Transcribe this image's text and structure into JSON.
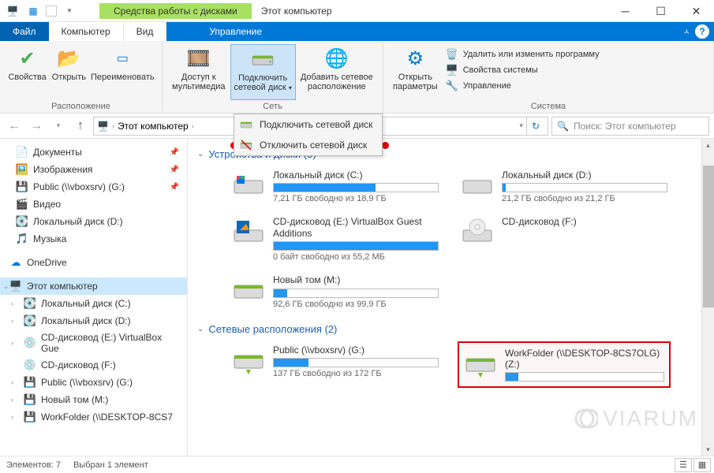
{
  "window": {
    "contextual_tab": "Средства работы с дисками",
    "title": "Этот компьютер"
  },
  "tabs": {
    "file": "Файл",
    "computer": "Компьютер",
    "view": "Вид",
    "manage": "Управление"
  },
  "ribbon": {
    "group_location": "Расположение",
    "group_network": "Сеть",
    "group_system": "Система",
    "properties": "Свойства",
    "open": "Открыть",
    "rename": "Переименовать",
    "media_access": "Доступ к\nмультимедиа",
    "map_network_drive": "Подключить\nсетевой диск",
    "add_network_location": "Добавить сетевое\nрасположение",
    "open_settings": "Открыть\nпараметры",
    "uninstall": "Удалить или изменить программу",
    "system_properties": "Свойства системы",
    "manage": "Управление"
  },
  "dropdown": {
    "connect": "Подключить сетевой диск",
    "disconnect": "Отключить сетевой диск"
  },
  "breadcrumb": {
    "this_pc": "Этот компьютер"
  },
  "search": {
    "placeholder": "Поиск: Этот компьютер"
  },
  "sidebar": {
    "documents": "Документы",
    "pictures": "Изображения",
    "public_g": "Public (\\\\vboxsrv) (G:)",
    "video": "Видео",
    "local_d": "Локальный диск (D:)",
    "music": "Музыка",
    "onedrive": "OneDrive",
    "this_pc": "Этот компьютер",
    "local_c": "Локальный диск (C:)",
    "local_d2": "Локальный диск (D:)",
    "cd_e": "CD-дисковод (E:) VirtualBox Gue",
    "cd_f": "CD-дисковод (F:)",
    "public_g2": "Public (\\\\vboxsrv) (G:)",
    "new_vol_m": "Новый том (M:)",
    "workfolder_z": "WorkFolder (\\\\DESKTOP-8CS7"
  },
  "sections": {
    "devices": "Устройства и диски (5)",
    "network": "Сетевые расположения (2)"
  },
  "drives": {
    "c": {
      "name": "Локальный диск (C:)",
      "free": "7,21 ГБ свободно из 18,9 ГБ",
      "fill": 62
    },
    "d": {
      "name": "Локальный диск (D:)",
      "free": "21,2 ГБ свободно из 21,2 ГБ",
      "fill": 2
    },
    "e": {
      "name": "CD-дисковод (E:) VirtualBox Guest Additions",
      "free": "0 байт свободно из 55,2 МБ",
      "fill": 100
    },
    "f": {
      "name": "CD-дисковод (F:)",
      "free": "",
      "fill": 0
    },
    "m": {
      "name": "Новый том (M:)",
      "free": "92,6 ГБ свободно из 99,9 ГБ",
      "fill": 8
    },
    "g": {
      "name": "Public (\\\\vboxsrv) (G:)",
      "free": "137 ГБ свободно из 172 ГБ",
      "fill": 21
    },
    "z": {
      "name": "WorkFolder (\\\\DESKTOP-8CS7OLG) (Z:)",
      "free": "",
      "fill": 8
    }
  },
  "status": {
    "items": "Элементов: 7",
    "selected": "Выбран 1 элемент"
  },
  "watermark": "VIARUM"
}
